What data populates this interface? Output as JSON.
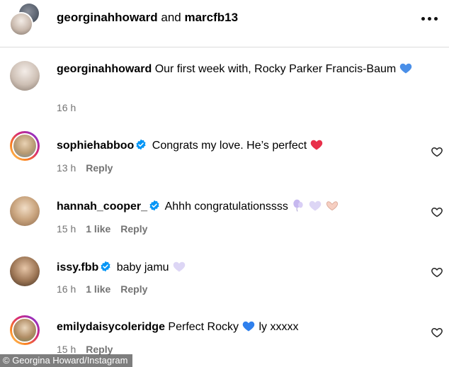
{
  "header": {
    "user1": "georginahhoward",
    "and": "and",
    "user2": "marcfb13"
  },
  "caption": {
    "username": "georginahhoward",
    "text": "Our first week with, Rocky Parker Francis-Baum",
    "time": "16 h"
  },
  "comments": [
    {
      "username": "sophiehabboo",
      "verified": true,
      "text": "Congrats my love. He’s perfect",
      "time": "13 h",
      "likes": "",
      "reply": "Reply"
    },
    {
      "username": "hannah_cooper_",
      "verified": true,
      "text": "Ahhh congratulationssss",
      "time": "15 h",
      "likes": "1 like",
      "reply": "Reply"
    },
    {
      "username": "issy.fbb",
      "verified": true,
      "text": "baby jamu",
      "time": "16 h",
      "likes": "1 like",
      "reply": "Reply"
    },
    {
      "username": "emilydaisycoleridge",
      "verified": false,
      "text": "Perfect Rocky",
      "text_after": "ly xxxxx",
      "time": "15 h",
      "likes": "",
      "reply": "Reply"
    }
  ],
  "credit": "© Georgina Howard/Instagram",
  "colors": {
    "verified_blue": "#0095f6",
    "meta_gray": "#737373",
    "heart_red": "#e8304a",
    "heart_blue": "#2f80ed",
    "heart_lilac": "#c9c1ee"
  },
  "icons": [
    "more-options-icon",
    "verified-badge-icon",
    "like-heart-outline-icon",
    "blue-heart-emoji",
    "red-heart-emoji",
    "white-heart-emoji",
    "balloon-emoji",
    "heart-hands-emoji"
  ]
}
